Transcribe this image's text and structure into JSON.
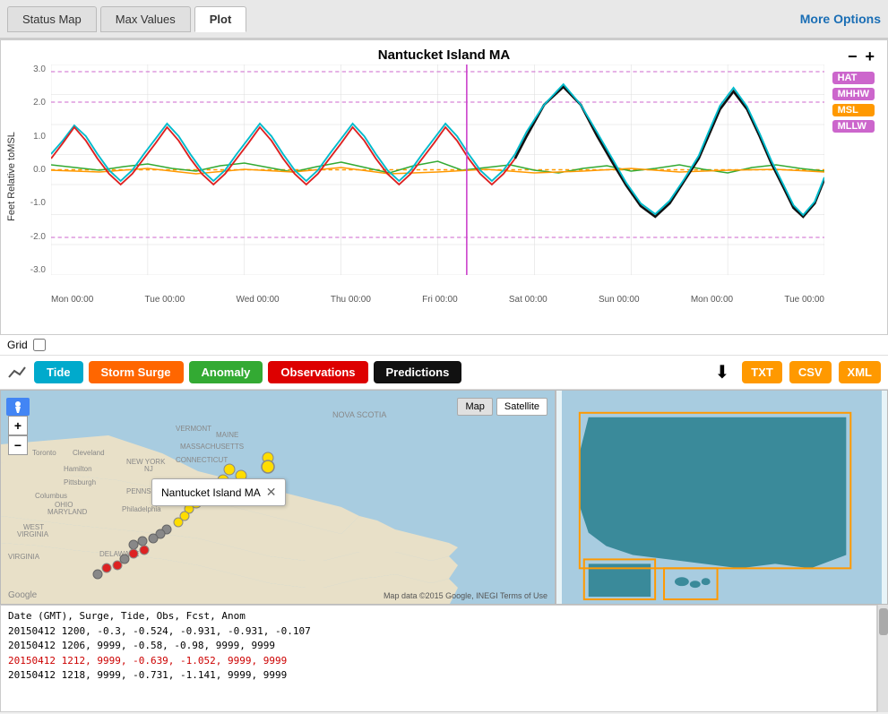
{
  "header": {
    "tab1": "Status Map",
    "tab2": "Max Values",
    "tab3": "Plot",
    "more_options": "More Options",
    "active_tab": "Plot"
  },
  "chart": {
    "title": "Nantucket Island MA",
    "zoom_minus": "−",
    "zoom_plus": "+",
    "y_label": "Feet Relative toMSL",
    "y_ticks": [
      "3.0",
      "2.0",
      "1.0",
      "0.0",
      "-1.0",
      "-2.0",
      "-3.0"
    ],
    "x_ticks": [
      "Mon 00:00",
      "Tue 00:00",
      "Wed 00:00",
      "Thu 00:00",
      "Fri 00:00",
      "Sat 00:00",
      "Sun 00:00",
      "Mon 00:00",
      "Tue 00:00"
    ],
    "legend": {
      "hat": {
        "label": "HAT",
        "color": "#cc66cc"
      },
      "mhhw": {
        "label": "MHHW",
        "color": "#cc66cc"
      },
      "msl": {
        "label": "MSL",
        "color": "#ff9900"
      },
      "mllw": {
        "label": "MLLW",
        "color": "#cc66cc"
      }
    }
  },
  "grid": {
    "label": "Grid"
  },
  "legend_buttons": {
    "tide": {
      "label": "Tide",
      "color": "#00aacc"
    },
    "storm_surge": {
      "label": "Storm Surge",
      "color": "#ff6600"
    },
    "anomaly": {
      "label": "Anomaly",
      "color": "#33aa33"
    },
    "observations": {
      "label": "Observations",
      "color": "#dd0000"
    },
    "predictions": {
      "label": "Predictions",
      "color": "#111111"
    }
  },
  "export_buttons": {
    "txt": {
      "label": "TXT",
      "color": "#ff9900"
    },
    "csv": {
      "label": "CSV",
      "color": "#ff9900"
    },
    "xml": {
      "label": "XML",
      "color": "#ff9900"
    }
  },
  "map": {
    "popup_label": "Nantucket Island MA",
    "popup_close": "✕",
    "map_btn": "Map",
    "satellite_btn": "Satellite",
    "zoom_plus": "+",
    "zoom_minus": "−",
    "google_logo": "Google",
    "data_credit": "Map data ©2015 Google, INEGI  Terms of Use"
  },
  "data_output": {
    "header_line": "Date (GMT), Surge, Tide, Obs, Fcst, Anom",
    "lines": [
      "20150412 1200, -0.3, -0.524, -0.931, -0.931, -0.107",
      "20150412 1206, 9999, -0.58, -0.98, 9999, 9999",
      "20150412 1212, 9999, -0.639, -1.052, 9999, 9999",
      "20150412 1218, 9999, -0.731, -1.141, 9999, 9999"
    ]
  }
}
